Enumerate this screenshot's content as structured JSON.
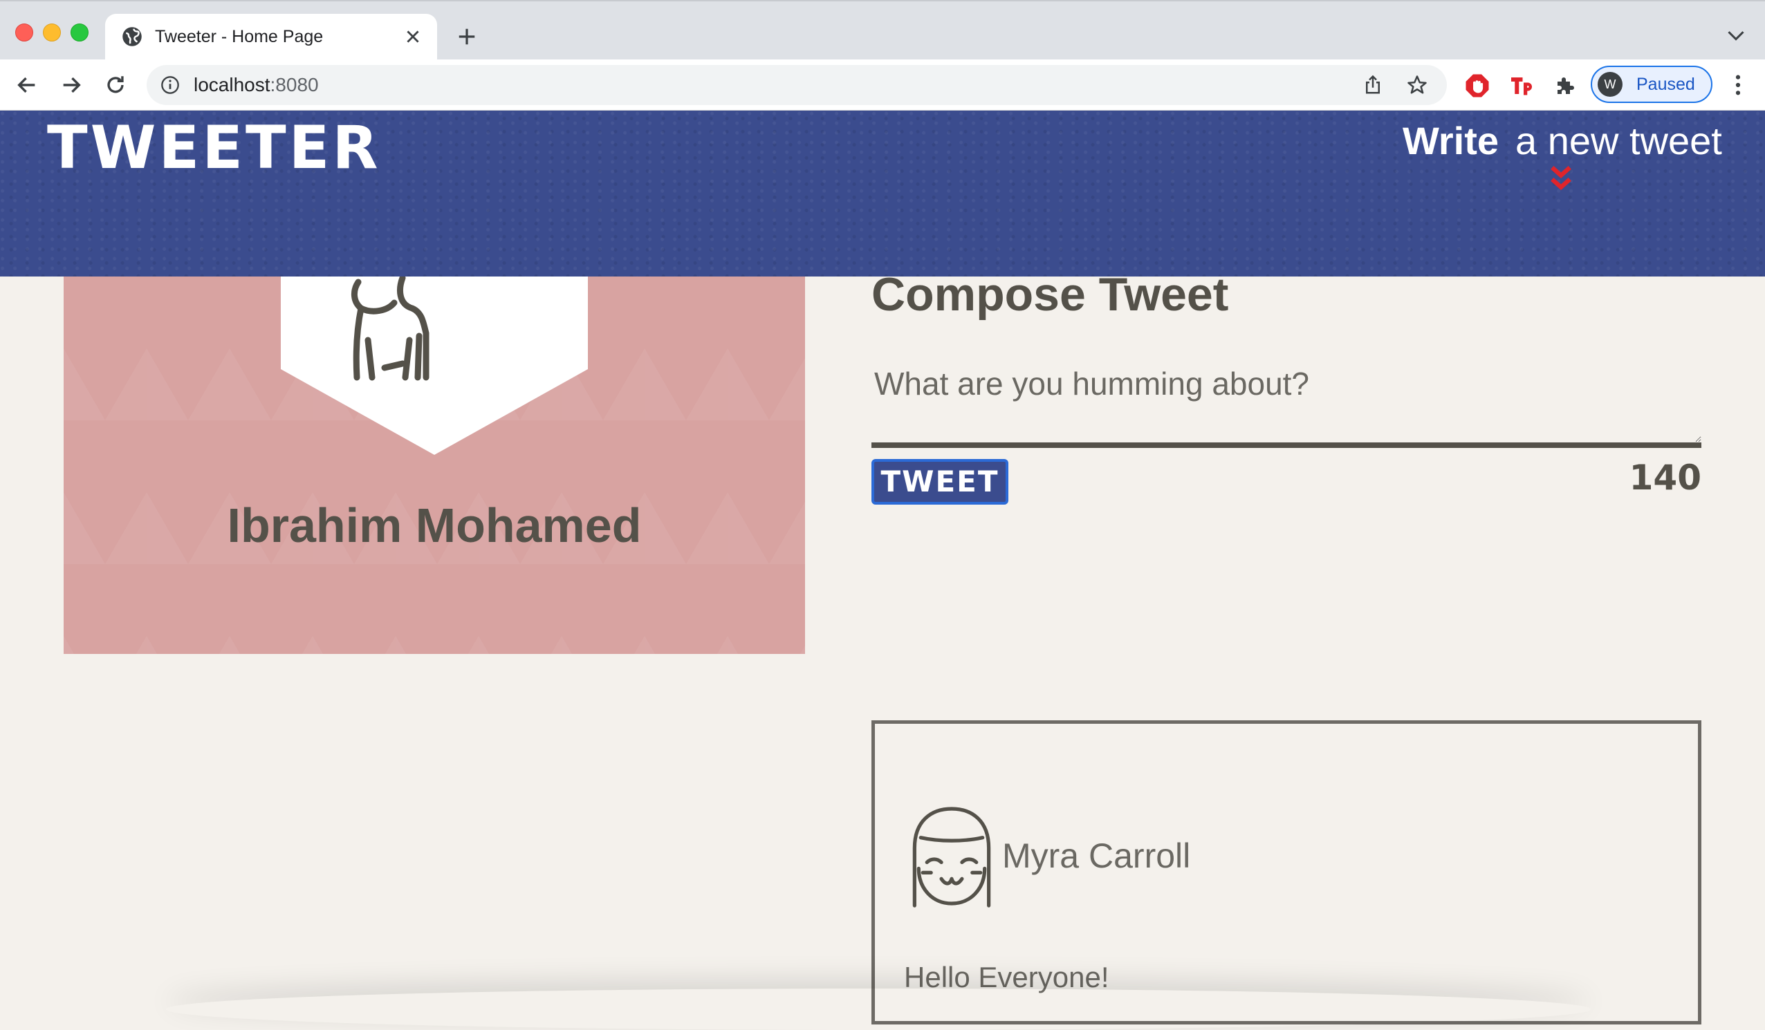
{
  "browser": {
    "tab_title": "Tweeter - Home Page",
    "url_host": "localhost",
    "url_port": ":8080",
    "profile_initial": "W",
    "profile_status": "Paused"
  },
  "nav": {
    "logo": "TWEETER",
    "write_bold": "Write",
    "write_rest": "a new tweet"
  },
  "profile": {
    "name": "Ibrahim Mohamed"
  },
  "compose": {
    "title": "Compose Tweet",
    "placeholder": "What are you humming about?",
    "button_label": "TWEET",
    "counter": "140"
  },
  "tweets": [
    {
      "author": "Myra Carroll",
      "text": "Hello Everyone!"
    }
  ],
  "colors": {
    "nav_bg": "#3b4c8e",
    "profile_bg": "#d8a3a1",
    "page_bg": "#f4f1ec",
    "text_dark": "#545149",
    "accent_red": "#e0242b"
  }
}
